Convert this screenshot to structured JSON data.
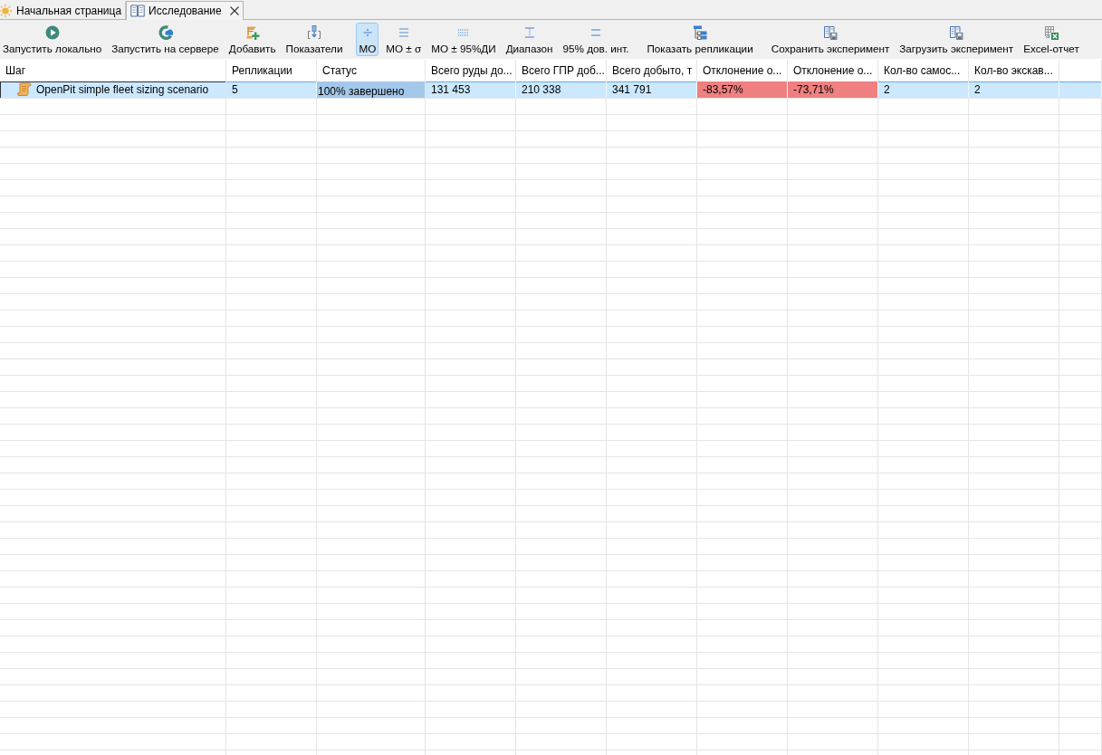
{
  "tabs": [
    {
      "kind": "start-page",
      "label": "Начальная страница",
      "selected": false,
      "closable": false
    },
    {
      "kind": "experiment",
      "label": "Исследование",
      "selected": true,
      "closable": true
    }
  ],
  "toolbar": {
    "actions": [
      {
        "kind": "run-local",
        "label": "Запустить локально"
      },
      {
        "kind": "run-server",
        "label": "Запустить на сервере"
      },
      {
        "kind": "add",
        "label": "Добавить"
      },
      {
        "kind": "metrics",
        "label": "Показатели"
      }
    ],
    "statistic_modes": [
      {
        "kind": "mean",
        "label": "МО",
        "selected": true
      },
      {
        "kind": "mean-sd",
        "label": "МО ± σ",
        "selected": false
      },
      {
        "kind": "mean-ci",
        "label": "МО ± 95%ДИ",
        "selected": false
      },
      {
        "kind": "range",
        "label": "Диапазон",
        "selected": false
      },
      {
        "kind": "ci",
        "label": "95% дов. инт.",
        "selected": false
      }
    ],
    "more_actions": [
      {
        "kind": "replications",
        "label": "Показать репликации"
      },
      {
        "kind": "save",
        "label": "Сохранить эксперимент"
      },
      {
        "kind": "load",
        "label": "Загрузить эксперимент"
      },
      {
        "kind": "excel",
        "label": "Excel-отчет"
      }
    ]
  },
  "table": {
    "columns": [
      "Шаг",
      "Репликации",
      "Статус",
      "Всего руды до...",
      "Всего ГПР доб...",
      "Всего добыто, т",
      "Отклонение о...",
      "Отклонение о...",
      "Кол-во самос...",
      "Кол-во экскав..."
    ],
    "rows": [
      {
        "selected": true,
        "cells": [
          {
            "kind": "step",
            "text": "OpenPit simple fleet sizing scenario"
          },
          {
            "kind": "text",
            "text": "5"
          },
          {
            "kind": "progress",
            "text": "100% завершено",
            "level": 1
          },
          {
            "kind": "text",
            "text": "131 453"
          },
          {
            "kind": "text",
            "text": "210 338"
          },
          {
            "kind": "text",
            "text": "341 791"
          },
          {
            "kind": "alert",
            "text": "-83,57%"
          },
          {
            "kind": "alert",
            "text": "-73,71%"
          },
          {
            "kind": "text",
            "text": "2"
          },
          {
            "kind": "text",
            "text": "2"
          }
        ]
      }
    ]
  }
}
